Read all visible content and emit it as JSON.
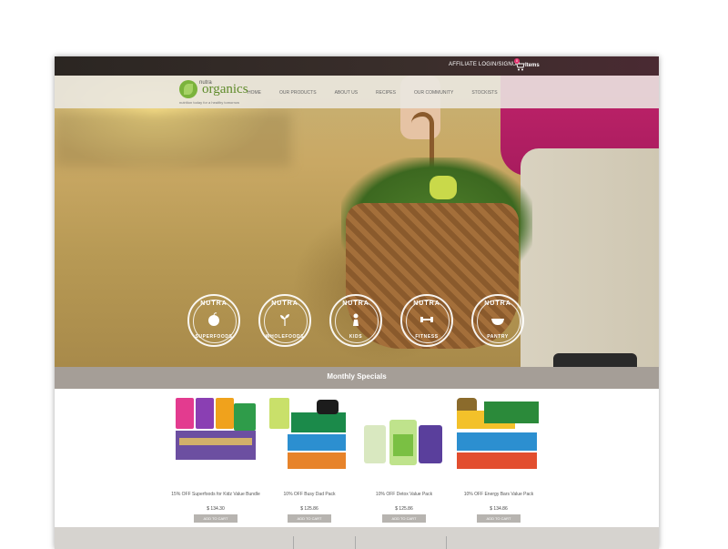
{
  "topbar": {
    "affiliate_label": "AFFILIATE LOGIN/SIGNUP",
    "cart_count": "0",
    "items_label": "Items"
  },
  "logo": {
    "brand_small": "nutra",
    "brand_main": "organics",
    "tagline": "nutrition today for a healthy tomorrow"
  },
  "nav": {
    "items": [
      {
        "label": "HOME"
      },
      {
        "label": "OUR PRODUCTS"
      },
      {
        "label": "ABOUT US"
      },
      {
        "label": "RECIPES"
      },
      {
        "label": "OUR COMMUNITY"
      },
      {
        "label": "STOCKISTS"
      }
    ]
  },
  "badges": [
    {
      "top": "NUTRA",
      "bottom": "SUPERFOODS",
      "icon": "apple-icon"
    },
    {
      "top": "NUTRA",
      "bottom": "WHOLEFOODS",
      "icon": "sprout-icon"
    },
    {
      "top": "NUTRA",
      "bottom": "KIDS",
      "icon": "child-icon"
    },
    {
      "top": "NUTRA",
      "bottom": "FITNESS",
      "icon": "dumbbell-icon"
    },
    {
      "top": "NUTRA",
      "bottom": "PANTRY",
      "icon": "bowl-icon"
    }
  ],
  "specials": {
    "title": "Monthly Specials"
  },
  "products": [
    {
      "name": "15% OFF Superfoods for Kidz Value Bundle",
      "price": "$ 134.30",
      "button": "ADD TO CART"
    },
    {
      "name": "10% OFF Busy Dad Pack",
      "price": "$ 125.86",
      "button": "ADD TO CART"
    },
    {
      "name": "10% OFF Detox Value Pack",
      "price": "$ 125.86",
      "button": "ADD TO CART"
    },
    {
      "name": "10% OFF Energy Bars Value Pack",
      "price": "$ 134.86",
      "button": "ADD TO CART"
    }
  ],
  "colors": {
    "topbar": "#2b2622",
    "specials_bar": "#a59e97",
    "button_gray": "#b7b4b0",
    "brand_green": "#5f8b2a"
  }
}
